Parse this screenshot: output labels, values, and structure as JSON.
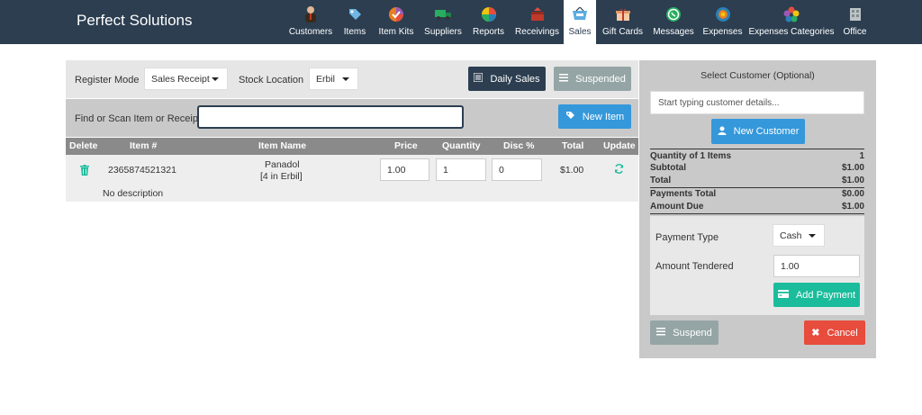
{
  "app": {
    "brand": "Perfect Solutions"
  },
  "nav": {
    "items": [
      {
        "label": "Customers",
        "icon": "customers-icon"
      },
      {
        "label": "Items",
        "icon": "items-icon"
      },
      {
        "label": "Item Kits",
        "icon": "item-kits-icon"
      },
      {
        "label": "Suppliers",
        "icon": "suppliers-icon"
      },
      {
        "label": "Reports",
        "icon": "reports-icon"
      },
      {
        "label": "Receivings",
        "icon": "receivings-icon"
      },
      {
        "label": "Sales",
        "icon": "sales-icon"
      },
      {
        "label": "Gift Cards",
        "icon": "gift-cards-icon"
      },
      {
        "label": "Messages",
        "icon": "messages-icon"
      },
      {
        "label": "Expenses",
        "icon": "expenses-icon"
      },
      {
        "label": "Expenses Categories",
        "icon": "expenses-categories-icon"
      },
      {
        "label": "Office",
        "icon": "office-icon"
      }
    ],
    "active": "Sales"
  },
  "register": {
    "mode_label": "Register Mode",
    "mode_value": "Sales Receipt",
    "location_label": "Stock Location",
    "location_value": "Erbil",
    "daily_sales_label": "Daily Sales",
    "suspended_label": "Suspended"
  },
  "find": {
    "label": "Find or Scan Item or Receipt",
    "value": "",
    "new_item_label": "New Item"
  },
  "cart": {
    "headers": {
      "delete": "Delete",
      "item_number": "Item #",
      "item_name": "Item Name",
      "price": "Price",
      "quantity": "Quantity",
      "discount": "Disc %",
      "total": "Total",
      "update": "Update"
    },
    "rows": [
      {
        "item_number": "2365874521321",
        "item_name": "Panadol",
        "stock_note": "[4 in Erbil]",
        "price": "1.00",
        "quantity": "1",
        "discount": "0",
        "total": "$1.00",
        "description": "No description"
      }
    ]
  },
  "customer": {
    "title": "Select Customer (Optional)",
    "placeholder": "Start typing customer details...",
    "new_customer_label": "New Customer"
  },
  "summary": {
    "quantity_label": "Quantity of 1 Items",
    "quantity_value": "1",
    "subtotal_label": "Subtotal",
    "subtotal_value": "$1.00",
    "total_label": "Total",
    "total_value": "$1.00",
    "payments_total_label": "Payments Total",
    "payments_total_value": "$0.00",
    "amount_due_label": "Amount Due",
    "amount_due_value": "$1.00"
  },
  "payment": {
    "type_label": "Payment Type",
    "type_value": "Cash",
    "tendered_label": "Amount Tendered",
    "tendered_value": "1.00",
    "add_payment_label": "Add Payment"
  },
  "actions": {
    "suspend_label": "Suspend",
    "cancel_label": "Cancel"
  },
  "colors": {
    "navbar": "#2c3e50",
    "teal": "#1abc9c",
    "blue": "#3498db",
    "red": "#e74c3c"
  }
}
